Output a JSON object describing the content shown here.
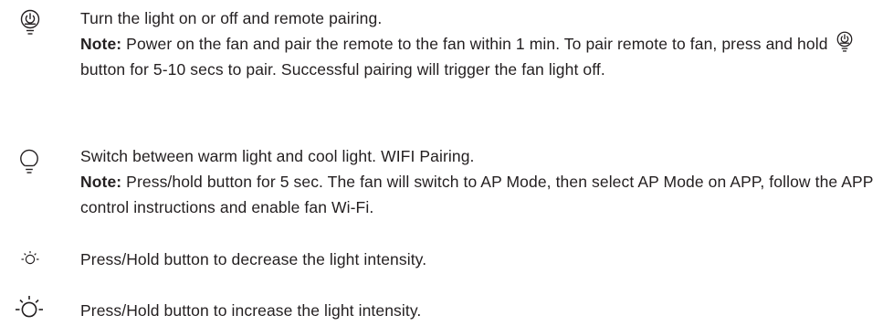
{
  "entries": [
    {
      "icon": "power-bulb-icon",
      "title": "Turn the light on or off and remote pairing.",
      "note_label": "Note:",
      "note_part1": " Power on the fan and pair the remote to the fan within 1 min. To pair remote to fan, press and hold",
      "inline_icon": "power-bulb-icon",
      "note_part2": "button for 5-10 secs to pair. Successful pairing will trigger the fan light off."
    },
    {
      "icon": "bulb-icon",
      "title": "Switch between warm light and cool light. WIFI Pairing.",
      "note_label": "Note:",
      "note_text": " Press/hold button for 5 sec. The fan will switch to AP Mode, then select AP Mode on APP, follow the APP control instructions and enable fan Wi-Fi."
    },
    {
      "icon": "sun-small-icon",
      "title": "Press/Hold button to decrease the light intensity."
    },
    {
      "icon": "sun-large-icon",
      "title": "Press/Hold button to increase the light intensity."
    }
  ],
  "colors": {
    "text": "#231f20",
    "icon_stroke": "#231f20"
  }
}
